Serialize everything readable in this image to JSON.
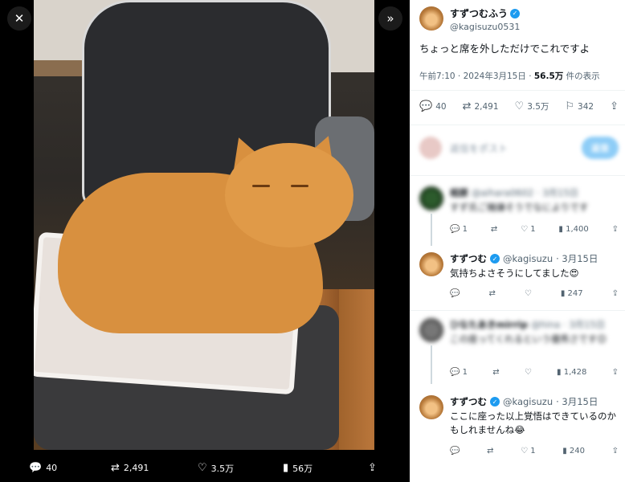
{
  "viewer": {
    "close_icon": "close-icon",
    "next_icon": "chevron-double-right-icon",
    "stats": {
      "replies": "40",
      "reposts": "2,491",
      "likes": "3.5万",
      "views": "56万"
    }
  },
  "tweet": {
    "author_name": "すずつむふう",
    "author_handle": "@kagisuzu0531",
    "text": "ちょっと席を外しただけでこれですよ",
    "time": "午前7:10 · 2024年3月15日 · ",
    "views_count": "56.5万",
    "views_label": " 件の表示",
    "actions": {
      "replies": "40",
      "reposts": "2,491",
      "likes": "3.5万",
      "bookmarks": "342"
    }
  },
  "reply_box": {
    "placeholder": "返信をポスト",
    "button": "返信"
  },
  "replies": [
    {
      "name": "相原",
      "handle": "@aihara0602 · 3月15日",
      "text": "すず氏ご機嫌そうでなによりです",
      "blurred": true,
      "stats": {
        "replies": "1",
        "reposts": "",
        "likes": "1",
        "views": "1,400"
      }
    },
    {
      "name": "すずつむ",
      "handle": "@kagisuzu",
      "date": "· 3月15日",
      "text": "気持ちよさそうにしてました😍",
      "blurred": false,
      "stats": {
        "replies": "",
        "reposts": "",
        "likes": "",
        "views": "247"
      }
    },
    {
      "name": "ひなたあきmirrip",
      "handle": "@hina · 3月15日",
      "text": "この座ってくれるという優秀さです😊",
      "blurred": true,
      "stats": {
        "replies": "1",
        "reposts": "",
        "likes": "",
        "views": "1,428"
      }
    },
    {
      "name": "すずつむ",
      "handle": "@kagisuzu",
      "date": "· 3月15日",
      "text": "ここに座った以上覚悟はできているのかもしれませんね😂",
      "blurred": false,
      "stats": {
        "replies": "",
        "reposts": "",
        "likes": "1",
        "views": "240"
      }
    }
  ],
  "colors": {
    "verified": "#1d9bf0",
    "muted": "#536471",
    "text": "#0f1419"
  }
}
